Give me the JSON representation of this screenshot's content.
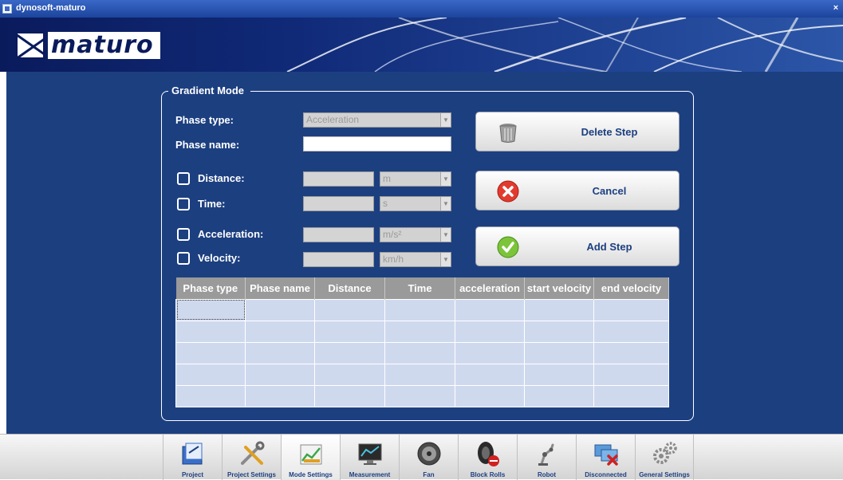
{
  "window": {
    "title": "dynosoft-maturo",
    "close_glyph": "×"
  },
  "brand": {
    "logo_text": "maturo"
  },
  "panel": {
    "title": "Gradient Mode",
    "phase_type_label": "Phase type:",
    "phase_type_value": "Acceleration",
    "phase_name_label": "Phase name:",
    "phase_name_value": "",
    "params": [
      {
        "label": "Distance:",
        "value": "",
        "unit": "m"
      },
      {
        "label": "Time:",
        "value": "",
        "unit": "s"
      },
      {
        "label": "Acceleration:",
        "value": "",
        "unit": "m/s²"
      },
      {
        "label": "Velocity:",
        "value": "",
        "unit": "km/h"
      }
    ]
  },
  "actions": {
    "delete_label": "Delete Step",
    "cancel_label": "Cancel",
    "add_label": "Add Step"
  },
  "table": {
    "columns": [
      "Phase type",
      "Phase name",
      "Distance",
      "Time",
      "acceleration",
      "start velocity",
      "end velocity"
    ],
    "rows": [
      [
        "",
        "",
        "",
        "",
        "",
        "",
        ""
      ],
      [
        "",
        "",
        "",
        "",
        "",
        "",
        ""
      ],
      [
        "",
        "",
        "",
        "",
        "",
        "",
        ""
      ],
      [
        "",
        "",
        "",
        "",
        "",
        "",
        ""
      ],
      [
        "",
        "",
        "",
        "",
        "",
        "",
        ""
      ]
    ]
  },
  "toolbar": {
    "items": [
      {
        "label": "Project",
        "icon": "project-icon"
      },
      {
        "label": "Project Settings",
        "icon": "tools-icon"
      },
      {
        "label": "Mode Settings",
        "icon": "chart-icon"
      },
      {
        "label": "Measurement",
        "icon": "monitor-icon"
      },
      {
        "label": "Fan",
        "icon": "fan-icon"
      },
      {
        "label": "Block Rolls",
        "icon": "tire-stop-icon"
      },
      {
        "label": "Robot",
        "icon": "robot-icon"
      },
      {
        "label": "Disconnected",
        "icon": "disconnected-icon"
      },
      {
        "label": "General Settings",
        "icon": "gears-icon"
      }
    ],
    "active": "Mode Settings"
  },
  "colors": {
    "main_bg": "#1c3f80",
    "banner_bg": "#0a1b5c",
    "table_header": "#9a9a9a",
    "table_cell": "#cfd9ee",
    "accent_text": "#1c3f80"
  }
}
